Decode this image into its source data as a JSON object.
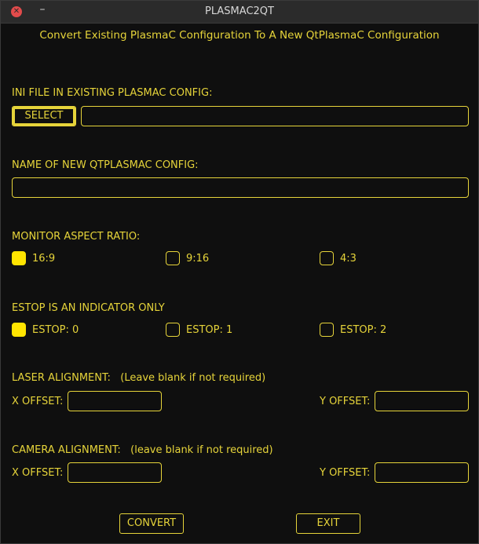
{
  "window": {
    "title": "PLASMAC2QT",
    "close_glyph": "✕",
    "minimize_glyph": "–"
  },
  "heading": "Convert Existing PlasmaC Configuration To A New QtPlasmaC Configuration",
  "ini": {
    "label": "INI FILE IN EXISTING PLASMAC CONFIG:",
    "select_label": "SELECT",
    "value": ""
  },
  "new_config": {
    "label": "NAME OF NEW QTPLASMAC CONFIG:",
    "value": ""
  },
  "aspect": {
    "label": "MONITOR ASPECT RATIO:",
    "options": [
      {
        "label": "16:9",
        "checked": true
      },
      {
        "label": "9:16",
        "checked": false
      },
      {
        "label": "4:3",
        "checked": false
      }
    ]
  },
  "estop": {
    "label": "ESTOP IS AN INDICATOR ONLY",
    "options": [
      {
        "label": "ESTOP: 0",
        "checked": true
      },
      {
        "label": "ESTOP: 1",
        "checked": false
      },
      {
        "label": "ESTOP: 2",
        "checked": false
      }
    ]
  },
  "laser": {
    "label": "LASER ALIGNMENT:   (Leave blank if not required)",
    "x_label": "X OFFSET:",
    "y_label": "Y OFFSET:",
    "x_value": "",
    "y_value": ""
  },
  "camera": {
    "label": "CAMERA ALIGNMENT:   (leave blank if not required)",
    "x_label": "X OFFSET:",
    "y_label": "Y OFFSET:",
    "x_value": "",
    "y_value": ""
  },
  "buttons": {
    "convert": "CONVERT",
    "exit": "EXIT"
  },
  "colors": {
    "accent": "#e6d43a",
    "checked_fill": "#ffe400",
    "background": "#0f0f0f"
  }
}
